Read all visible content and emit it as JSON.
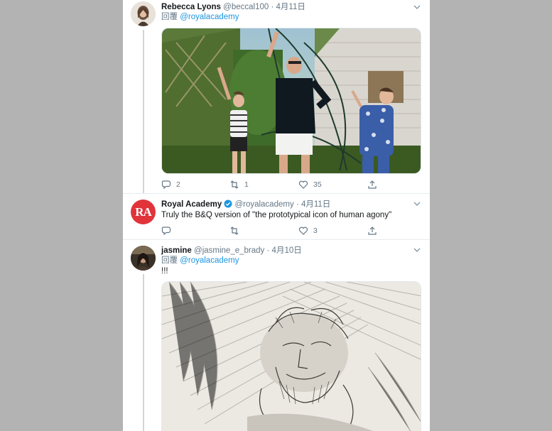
{
  "tweets": [
    {
      "name": "Rebecca Lyons",
      "handle": "@beccal100",
      "separator": "·",
      "date": "4月11日",
      "reply_prefix": "回覆",
      "reply_to": "@royalacademy",
      "counts": {
        "reply": "2",
        "retweet": "1",
        "like": "35"
      }
    },
    {
      "name": "Royal Academy",
      "handle": "@royalacademy",
      "separator": "·",
      "date": "4月11日",
      "avatar_text": "RA",
      "text": "Truly the B&Q version of \"the prototypical icon of human agony\"",
      "counts": {
        "reply": "",
        "retweet": "",
        "like": "3"
      }
    },
    {
      "name": "jasmine",
      "handle": "@jasmine_e_brady",
      "separator": "·",
      "date": "4月10日",
      "reply_prefix": "回覆",
      "reply_to": "@royalacademy",
      "text": "!!!"
    }
  ],
  "colors": {
    "accent": "#1b95e0",
    "ra_red": "#e0343a",
    "text_secondary": "#657786"
  }
}
